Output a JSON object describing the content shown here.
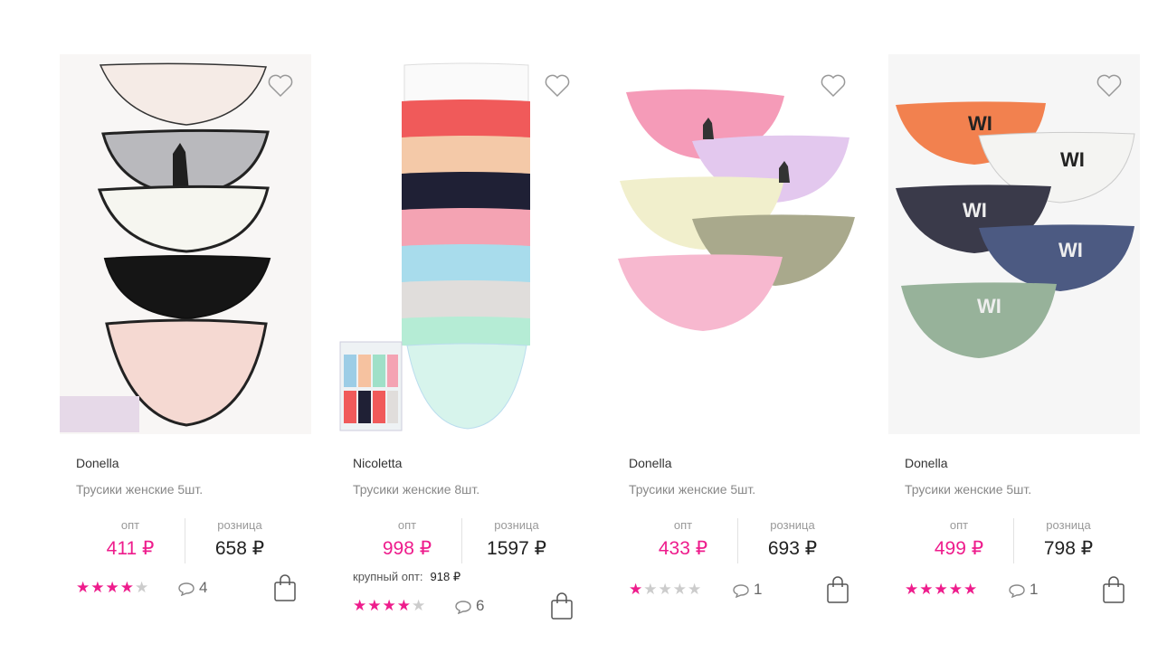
{
  "accent_color": "#ee1c8c",
  "labels": {
    "opt": "опт",
    "retail": "розница"
  },
  "products": [
    {
      "brand": "Donella",
      "title": "Трусики женские 5шт.",
      "price_opt": "411 ₽",
      "price_retail": "658 ₽",
      "rating": 4,
      "reviews": "4",
      "icons": [
        "heart-icon",
        "comment-icon",
        "shopping-bag-icon"
      ]
    },
    {
      "brand": "Nicoletta",
      "title": "Трусики женские 8шт.",
      "price_opt": "998 ₽",
      "price_retail": "1597 ₽",
      "bulk_label": "крупный опт:",
      "bulk_price": "918 ₽",
      "rating": 4,
      "reviews": "6",
      "icons": [
        "heart-icon",
        "comment-icon",
        "shopping-bag-icon"
      ]
    },
    {
      "brand": "Donella",
      "title": "Трусики женские 5шт.",
      "price_opt": "433 ₽",
      "price_retail": "693 ₽",
      "rating": 1,
      "reviews": "1",
      "icons": [
        "heart-icon",
        "comment-icon",
        "shopping-bag-icon"
      ]
    },
    {
      "brand": "Donella",
      "title": "Трусики женские 5шт.",
      "price_opt": "499 ₽",
      "price_retail": "798 ₽",
      "rating": 5,
      "reviews": "1",
      "icons": [
        "heart-icon",
        "comment-icon",
        "shopping-bag-icon"
      ]
    }
  ]
}
